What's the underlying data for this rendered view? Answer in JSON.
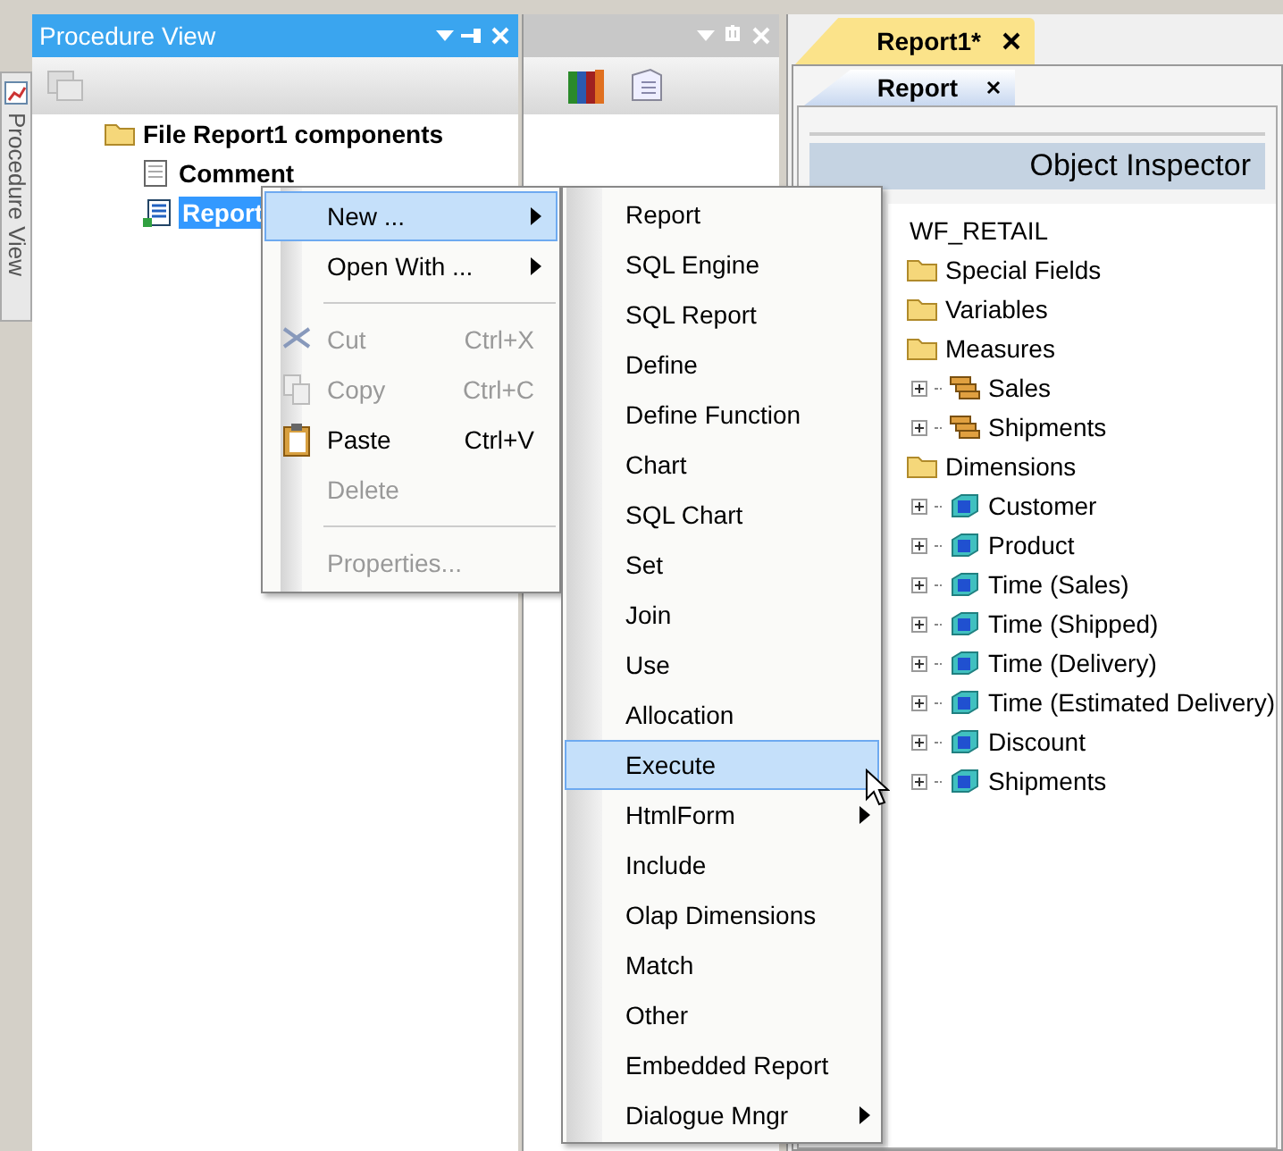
{
  "side_tab": {
    "label": "Procedure View"
  },
  "procedure_panel": {
    "title": "Procedure View",
    "tree": {
      "label": "File Report1 components",
      "children": [
        {
          "label": "Comment",
          "kind": "comment",
          "selected": false
        },
        {
          "label": "Report",
          "kind": "report",
          "selected": true
        }
      ]
    }
  },
  "document_tabs": [
    {
      "label": "Report1*",
      "selected": true
    }
  ],
  "inner_tabs": [
    {
      "label": "Report",
      "selected": true
    }
  ],
  "inspector": {
    "title": "Object Inspector",
    "root": "WF_RETAIL",
    "folders": [
      {
        "label": "Special Fields"
      },
      {
        "label": "Variables"
      },
      {
        "label": "Measures",
        "children": [
          {
            "label": "Sales",
            "kind": "measure",
            "expanded": false
          },
          {
            "label": "Shipments",
            "kind": "measure",
            "expanded": false
          }
        ]
      },
      {
        "label": "Dimensions",
        "children": [
          {
            "label": "Customer",
            "kind": "dimension",
            "expanded": false
          },
          {
            "label": "Product",
            "kind": "dimension",
            "expanded": false
          },
          {
            "label": "Time (Sales)",
            "kind": "dimension",
            "expanded": false
          },
          {
            "label": "Time (Shipped)",
            "kind": "dimension",
            "expanded": false
          },
          {
            "label": "Time (Delivery)",
            "kind": "dimension",
            "expanded": false
          },
          {
            "label": "Time (Estimated Delivery)",
            "kind": "dimension",
            "expanded": false
          },
          {
            "label": "Discount",
            "kind": "dimension",
            "expanded": false
          },
          {
            "label": "Shipments",
            "kind": "dimension",
            "expanded": false
          }
        ]
      }
    ]
  },
  "context_menu": [
    {
      "kind": "item",
      "label": "New ...",
      "submenu": true,
      "disabled": false,
      "selected": true
    },
    {
      "kind": "item",
      "label": "Open With ...",
      "submenu": true,
      "disabled": false,
      "selected": false
    },
    {
      "kind": "separator"
    },
    {
      "kind": "cut",
      "label": "Cut",
      "shortcut": "Ctrl+X",
      "disabled": true,
      "selected": false
    },
    {
      "kind": "copy",
      "label": "Copy",
      "shortcut": "Ctrl+C",
      "disabled": true,
      "selected": false
    },
    {
      "kind": "paste",
      "label": "Paste",
      "shortcut": "Ctrl+V",
      "disabled": false,
      "selected": false
    },
    {
      "kind": "item",
      "label": "Delete",
      "disabled": true,
      "selected": false
    },
    {
      "kind": "separator"
    },
    {
      "kind": "item",
      "label": "Properties...",
      "disabled": true,
      "selected": false
    }
  ],
  "submenu": [
    {
      "label": "Report",
      "submenu": false,
      "selected": false
    },
    {
      "label": "SQL Engine",
      "submenu": false,
      "selected": false
    },
    {
      "label": "SQL Report",
      "submenu": false,
      "selected": false
    },
    {
      "label": "Define",
      "submenu": false,
      "selected": false
    },
    {
      "label": "Define Function",
      "submenu": false,
      "selected": false
    },
    {
      "label": "Chart",
      "submenu": false,
      "selected": false
    },
    {
      "label": "SQL Chart",
      "submenu": false,
      "selected": false
    },
    {
      "label": "Set",
      "submenu": false,
      "selected": false
    },
    {
      "label": "Join",
      "submenu": false,
      "selected": false
    },
    {
      "label": "Use",
      "submenu": false,
      "selected": false
    },
    {
      "label": "Allocation",
      "submenu": false,
      "selected": false
    },
    {
      "label": "Execute",
      "submenu": false,
      "selected": true
    },
    {
      "label": "HtmlForm",
      "submenu": true,
      "selected": false
    },
    {
      "label": "Include",
      "submenu": false,
      "selected": false
    },
    {
      "label": "Olap Dimensions",
      "submenu": false,
      "selected": false
    },
    {
      "label": "Match",
      "submenu": false,
      "selected": false
    },
    {
      "label": "Other",
      "submenu": false,
      "selected": false
    },
    {
      "label": "Embedded Report",
      "submenu": false,
      "selected": false
    },
    {
      "label": "Dialogue Mngr",
      "submenu": true,
      "selected": false
    }
  ]
}
